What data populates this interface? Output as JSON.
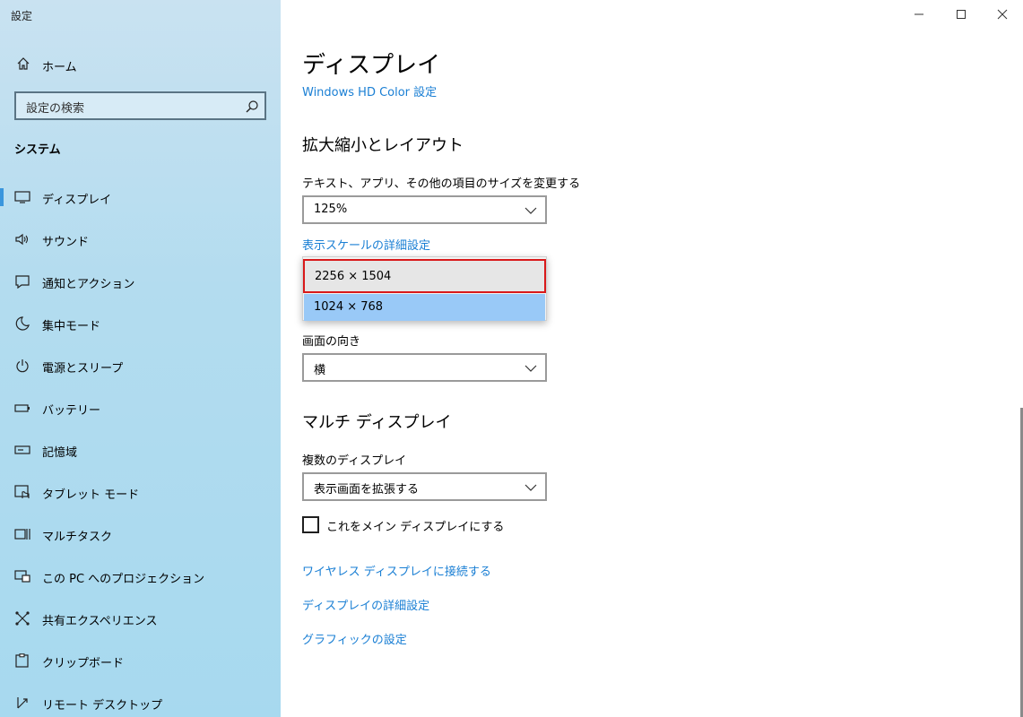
{
  "app": {
    "title": "設定",
    "window_controls": [
      "minimize-icon",
      "maximize-icon",
      "close-icon"
    ]
  },
  "sidebar": {
    "home_label": "ホーム",
    "search_placeholder": "設定の検索",
    "section_title": "システム",
    "items": [
      {
        "label": "ディスプレイ",
        "icon": "monitor-icon",
        "active": true
      },
      {
        "label": "サウンド",
        "icon": "speaker-icon"
      },
      {
        "label": "通知とアクション",
        "icon": "notification-icon"
      },
      {
        "label": "集中モード",
        "icon": "moon-icon"
      },
      {
        "label": "電源とスリープ",
        "icon": "power-icon"
      },
      {
        "label": "バッテリー",
        "icon": "battery-icon"
      },
      {
        "label": "記憶域",
        "icon": "storage-icon"
      },
      {
        "label": "タブレット モード",
        "icon": "tablet-icon"
      },
      {
        "label": "マルチタスク",
        "icon": "multitask-icon"
      },
      {
        "label": "この PC へのプロジェクション",
        "icon": "projection-icon"
      },
      {
        "label": "共有エクスペリエンス",
        "icon": "share-icon"
      },
      {
        "label": "クリップボード",
        "icon": "clipboard-icon"
      },
      {
        "label": "リモート デスクトップ",
        "icon": "remote-desktop-icon"
      }
    ],
    "accent_color": "#3a96dd"
  },
  "main": {
    "title": "ディスプレイ",
    "hd_color_link": "Windows HD Color 設定",
    "scale_section": {
      "heading": "拡大縮小とレイアウト",
      "size_label": "テキスト、アプリ、その他の項目のサイズを変更する",
      "size_value": "125%",
      "advanced_link": "表示スケールの詳細設定",
      "resolution_options": [
        "2256 × 1504",
        "1024 × 768"
      ],
      "orientation_label": "画面の向き",
      "orientation_value": "横"
    },
    "multi_section": {
      "heading": "マルチ ディスプレイ",
      "multi_label": "複数のディスプレイ",
      "multi_value": "表示画面を拡張する",
      "main_display_checkbox": "これをメイン ディスプレイにする",
      "main_display_checked": false,
      "links": [
        "ワイヤレス ディスプレイに接続する",
        "ディスプレイの詳細設定",
        "グラフィックの設定"
      ]
    }
  }
}
